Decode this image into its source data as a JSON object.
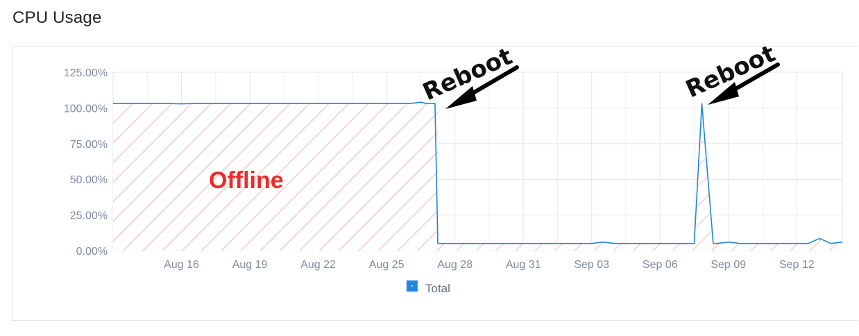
{
  "page": {
    "title": "CPU Usage"
  },
  "chart_data": {
    "type": "line",
    "ylim": [
      0,
      125
    ],
    "y_ticks": [
      0,
      25,
      50,
      75,
      100,
      125
    ],
    "y_tick_labels": [
      "0.00%",
      "25.00%",
      "50.00%",
      "75.00%",
      "100.00%",
      "125.00%"
    ],
    "xlim": [
      "2025-08-13",
      "2025-09-14"
    ],
    "x_ticks": [
      "2025-08-16",
      "2025-08-19",
      "2025-08-22",
      "2025-08-25",
      "2025-08-28",
      "2025-08-31",
      "2025-09-03",
      "2025-09-06",
      "2025-09-09",
      "2025-09-12"
    ],
    "x_tick_labels": [
      "Aug 16",
      "Aug 19",
      "Aug 22",
      "Aug 25",
      "Aug 28",
      "Aug 31",
      "Sep 03",
      "Sep 06",
      "Sep 09",
      "Sep 12"
    ],
    "grid": true,
    "legend_position": "bottom",
    "series": [
      {
        "name": "Total",
        "color": "#1f87e0",
        "x": [
          "2025-08-13 00:00",
          "2025-08-13 12:00",
          "2025-08-14 00:00",
          "2025-08-14 12:00",
          "2025-08-15 00:00",
          "2025-08-15 12:00",
          "2025-08-16 00:00",
          "2025-08-16 12:00",
          "2025-08-17 00:00",
          "2025-08-17 12:00",
          "2025-08-18 00:00",
          "2025-08-18 12:00",
          "2025-08-19 00:00",
          "2025-08-19 12:00",
          "2025-08-20 00:00",
          "2025-08-20 12:00",
          "2025-08-21 00:00",
          "2025-08-21 12:00",
          "2025-08-22 00:00",
          "2025-08-22 12:00",
          "2025-08-23 00:00",
          "2025-08-23 12:00",
          "2025-08-24 00:00",
          "2025-08-24 12:00",
          "2025-08-25 00:00",
          "2025-08-25 12:00",
          "2025-08-26 00:00",
          "2025-08-26 12:00",
          "2025-08-26 18:00",
          "2025-08-27 03:00",
          "2025-08-27 06:00",
          "2025-08-27 12:00",
          "2025-08-28 00:00",
          "2025-08-28 12:00",
          "2025-08-29 00:00",
          "2025-08-29 12:00",
          "2025-08-30 00:00",
          "2025-08-30 12:00",
          "2025-08-31 00:00",
          "2025-08-31 12:00",
          "2025-09-01 00:00",
          "2025-09-01 12:00",
          "2025-09-02 00:00",
          "2025-09-02 12:00",
          "2025-09-03 00:00",
          "2025-09-03 12:00",
          "2025-09-04 00:00",
          "2025-09-04 12:00",
          "2025-09-05 00:00",
          "2025-09-05 12:00",
          "2025-09-06 00:00",
          "2025-09-06 12:00",
          "2025-09-07 00:00",
          "2025-09-07 12:00",
          "2025-09-07 20:00",
          "2025-09-08 08:00",
          "2025-09-08 12:00",
          "2025-09-09 00:00",
          "2025-09-09 12:00",
          "2025-09-10 00:00",
          "2025-09-10 12:00",
          "2025-09-11 00:00",
          "2025-09-11 12:00",
          "2025-09-12 00:00",
          "2025-09-12 12:00",
          "2025-09-13 00:00",
          "2025-09-13 12:00",
          "2025-09-14 00:00"
        ],
        "y": [
          103,
          103,
          103,
          103,
          103,
          103,
          102.8,
          103,
          103,
          103,
          103,
          103,
          103,
          103,
          103,
          103,
          103,
          103,
          103,
          103,
          103,
          103,
          103,
          103,
          103,
          103,
          103,
          104,
          103,
          103,
          5,
          5,
          5,
          5,
          5,
          5,
          5,
          5,
          5,
          5,
          5,
          5,
          5,
          5,
          5,
          6,
          5,
          5,
          5,
          5,
          5,
          5,
          5,
          5,
          103,
          5,
          5,
          6,
          5,
          5,
          5,
          5,
          5,
          5,
          5,
          8.5,
          5,
          6
        ]
      }
    ]
  },
  "annotations": {
    "offline_label": "Offline",
    "reboot_labels": [
      "Reboot",
      "Reboot"
    ],
    "offline_range": [
      "2025-08-13 00:00",
      "2025-08-27 06:00"
    ],
    "offline_level": 100,
    "reboot_dates": [
      "2025-08-27 06:00",
      "2025-09-07 20:00"
    ]
  }
}
